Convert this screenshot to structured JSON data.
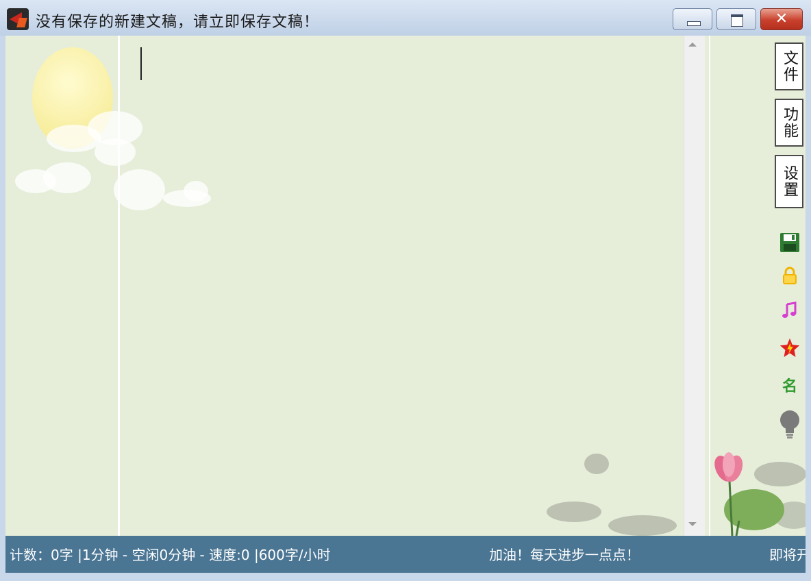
{
  "window": {
    "title": "没有保存的新建文稿，请立即保存文稿！",
    "minimize_icon": "minimize-icon",
    "maximize_icon": "maximize-icon",
    "close_label": "✕"
  },
  "editor": {
    "text": ""
  },
  "sidebar": {
    "menus": [
      {
        "label": "文件"
      },
      {
        "label": "功能"
      },
      {
        "label": "设置"
      }
    ],
    "icons": [
      {
        "name": "save-icon",
        "color": "#2e7d32"
      },
      {
        "name": "lock-icon",
        "color": "#f0b400"
      },
      {
        "name": "music-note-icon",
        "color": "#d63fd0"
      },
      {
        "name": "star-badge-icon",
        "color": "#e02020"
      },
      {
        "name": "name-badge-icon",
        "color": "#2e9a2e",
        "text": "名"
      },
      {
        "name": "lightbulb-icon",
        "color": "#7a7a7a"
      }
    ]
  },
  "statusbar": {
    "stats": "计数：0字 |1分钟 - 空闲0分钟 - 速度:0 |600字/小时",
    "motto": "加油！每天进步一点点！",
    "next": "即将开"
  },
  "colors": {
    "paper": "#e6eed9",
    "statusbar": "#4a7593",
    "titlebar": "#c9d7ea"
  }
}
